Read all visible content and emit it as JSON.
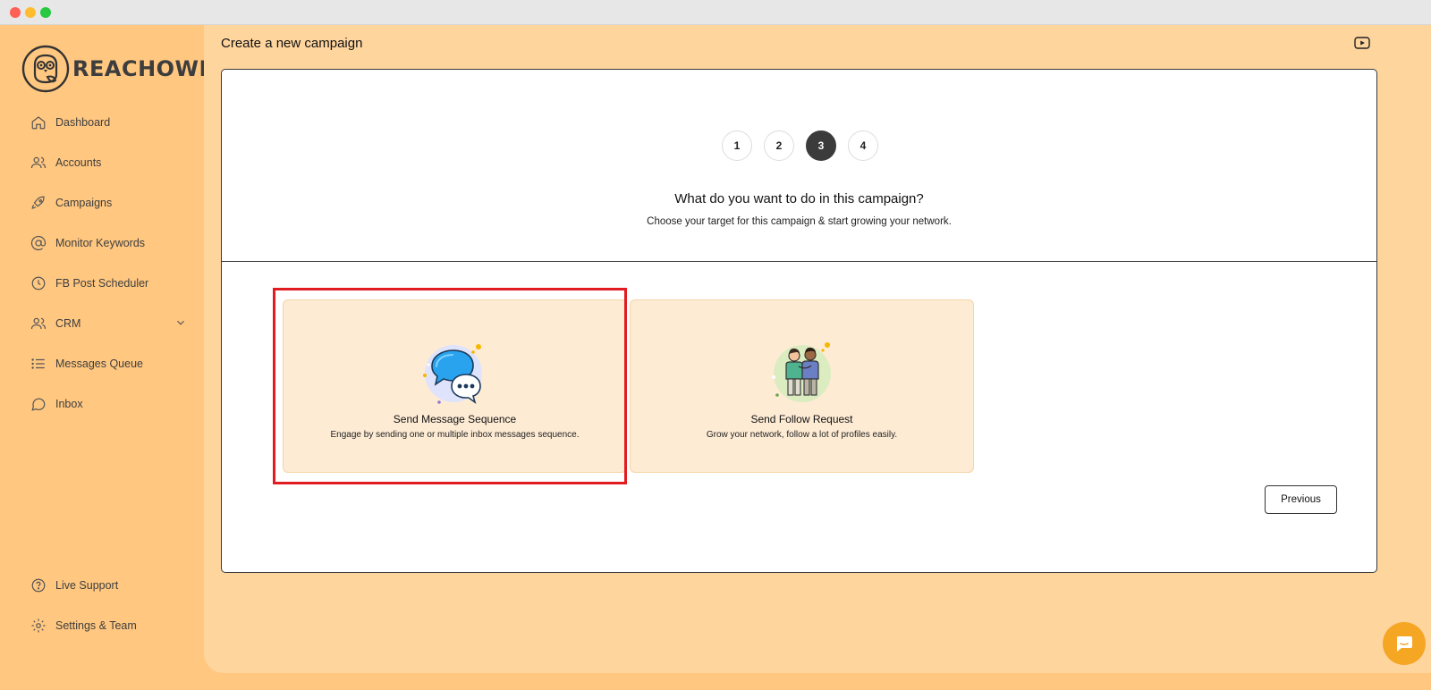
{
  "brand": {
    "name": "REACHOWL"
  },
  "sidebar": {
    "items": [
      {
        "label": "Dashboard",
        "icon": "home-icon"
      },
      {
        "label": "Accounts",
        "icon": "users-icon"
      },
      {
        "label": "Campaigns",
        "icon": "rocket-icon"
      },
      {
        "label": "Monitor Keywords",
        "icon": "at-sign-icon"
      },
      {
        "label": "FB Post Scheduler",
        "icon": "clock-icon"
      },
      {
        "label": "CRM",
        "icon": "users-icon"
      },
      {
        "label": "Messages Queue",
        "icon": "list-icon"
      },
      {
        "label": "Inbox",
        "icon": "message-circle-icon"
      }
    ],
    "bottom_items": [
      {
        "label": "Live Support",
        "icon": "help-circle-icon"
      },
      {
        "label": "Settings & Team",
        "icon": "gear-icon"
      }
    ]
  },
  "header": {
    "title": "Create a new campaign"
  },
  "wizard": {
    "steps": [
      "1",
      "2",
      "3",
      "4"
    ],
    "active_step": "3",
    "question": "What do you want to do in this campaign?",
    "subtitle": "Choose your target for this campaign & start growing your network.",
    "options": [
      {
        "title": "Send Message Sequence",
        "description": "Engage by sending one or multiple inbox messages sequence.",
        "icon": "chat-bubbles-icon",
        "highlighted": true
      },
      {
        "title": "Send Follow Request",
        "description": "Grow your network, follow a lot of profiles easily.",
        "icon": "two-people-icon",
        "highlighted": false
      }
    ],
    "previous_label": "Previous"
  },
  "colors": {
    "sidebar_bg": "#ffc780",
    "main_bg": "#ffd59e",
    "option_bg": "#fdebd4",
    "active_step": "#3b3b3b",
    "highlight_border": "#e11d22",
    "chat_button": "#f5a623"
  }
}
